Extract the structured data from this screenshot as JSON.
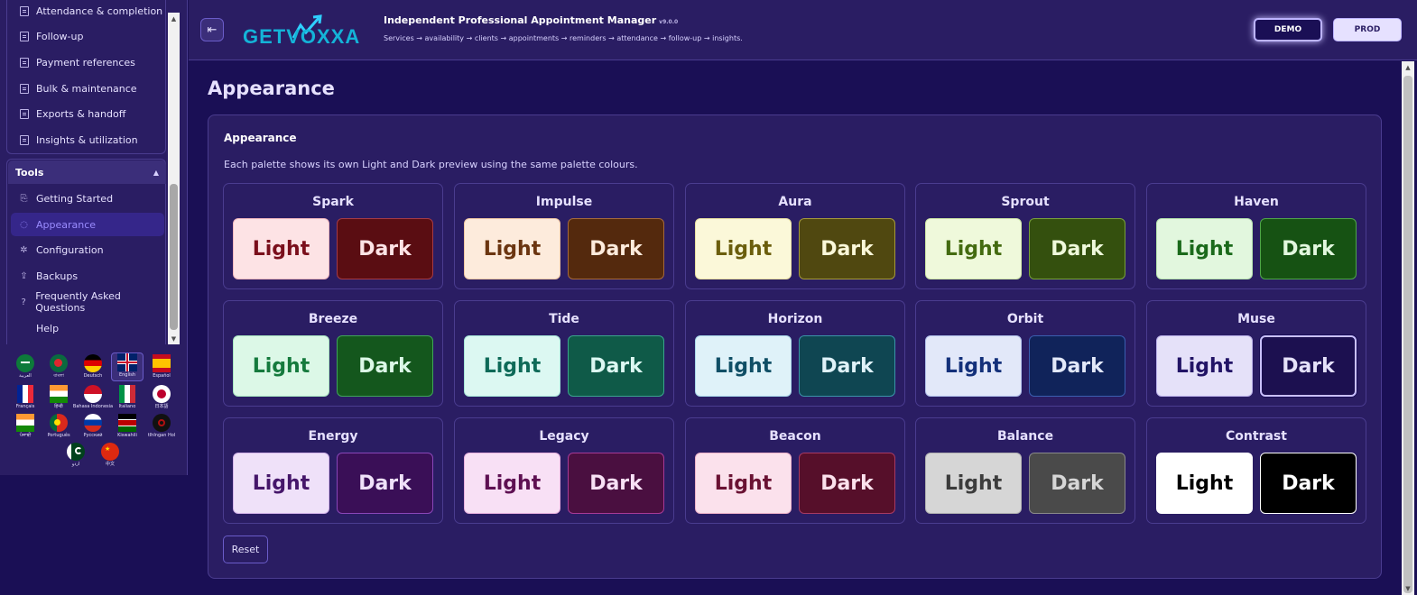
{
  "sidebar": {
    "partial_item": "Attendance & completion",
    "items": [
      {
        "label": "Follow-up"
      },
      {
        "label": "Payment references"
      },
      {
        "label": "Bulk & maintenance"
      },
      {
        "label": "Exports & handoff"
      },
      {
        "label": "Insights & utilization"
      }
    ],
    "tools": {
      "header": "Tools",
      "items": [
        {
          "label": "Getting Started",
          "icon": "start-icon"
        },
        {
          "label": "Appearance",
          "icon": "palette-icon",
          "active": true
        },
        {
          "label": "Configuration",
          "icon": "gear-icon"
        },
        {
          "label": "Backups",
          "icon": "upload-icon"
        },
        {
          "label": "Frequently Asked Questions",
          "icon": "help-circle-icon"
        },
        {
          "label": "Help",
          "icon": ""
        }
      ]
    },
    "languages": [
      {
        "label": "العربية",
        "code": "ar"
      },
      {
        "label": "বাংলা",
        "code": "bn"
      },
      {
        "label": "Deutsch",
        "code": "de"
      },
      {
        "label": "English",
        "code": "en",
        "selected": true
      },
      {
        "label": "Español",
        "code": "es"
      },
      {
        "label": "Français",
        "code": "fr"
      },
      {
        "label": "हिन्दी",
        "code": "hi"
      },
      {
        "label": "Bahasa Indonesia",
        "code": "id"
      },
      {
        "label": "Italiano",
        "code": "it"
      },
      {
        "label": "日本語",
        "code": "ja"
      },
      {
        "label": "ਪੰਜਾਬੀ",
        "code": "pa"
      },
      {
        "label": "Português",
        "code": "pt"
      },
      {
        "label": "Русский",
        "code": "ru"
      },
      {
        "label": "Kiswahili",
        "code": "sw"
      },
      {
        "label": "tlhIngan Hol",
        "code": "tlh"
      },
      {
        "label": "اردو",
        "code": "ur"
      },
      {
        "label": "中文",
        "code": "zh"
      }
    ]
  },
  "header": {
    "logo_text": "GETVOXXA",
    "app_title": "Independent Professional Appointment Manager",
    "version": "v9.0.0",
    "subtitle": "Services → availability → clients → appointments → reminders → attendance → follow-up → insights.",
    "env_demo": "DEMO",
    "env_prod": "PROD"
  },
  "main": {
    "page_title": "Appearance",
    "card_title": "Appearance",
    "description": "Each palette shows its own Light and Dark preview using the same palette colours.",
    "light_label": "Light",
    "dark_label": "Dark",
    "reset_label": "Reset",
    "selected_palette": "Muse",
    "selected_mode": "Dark",
    "palettes": [
      {
        "name": "Spark",
        "light_bg": "#fde3e5",
        "light_fg": "#7a0f1c",
        "light_border": "#f2b8bf",
        "dark_bg": "#5a0d12",
        "dark_fg": "#fde3e5",
        "dark_border": "#a53a44"
      },
      {
        "name": "Impulse",
        "light_bg": "#fdebdc",
        "light_fg": "#6b3510",
        "light_border": "#f0c7a3",
        "dark_bg": "#54290d",
        "dark_fg": "#fdebdc",
        "dark_border": "#a66a3a"
      },
      {
        "name": "Aura",
        "light_bg": "#fbf8d9",
        "light_fg": "#6b5e0c",
        "light_border": "#e9e0a1",
        "dark_bg": "#504810",
        "dark_fg": "#fbf8d9",
        "dark_border": "#a69a3a"
      },
      {
        "name": "Sprout",
        "light_bg": "#eff9db",
        "light_fg": "#446b10",
        "light_border": "#cde6a5",
        "dark_bg": "#34500e",
        "dark_fg": "#eff9db",
        "dark_border": "#79a23a"
      },
      {
        "name": "Haven",
        "light_bg": "#e2f7de",
        "light_fg": "#1b6a1b",
        "light_border": "#b5e3ad",
        "dark_bg": "#165213",
        "dark_fg": "#e2f7de",
        "dark_border": "#4ea548"
      },
      {
        "name": "Breeze",
        "light_bg": "#dcf8e7",
        "light_fg": "#157a3d",
        "light_border": "#a8e6c0",
        "dark_bg": "#14571d",
        "dark_fg": "#dcf8e7",
        "dark_border": "#3fa558"
      },
      {
        "name": "Tide",
        "light_bg": "#dcf8f2",
        "light_fg": "#0e6a58",
        "light_border": "#a6e6d8",
        "dark_bg": "#0f5a48",
        "dark_fg": "#dcf8f2",
        "dark_border": "#3aa58c"
      },
      {
        "name": "Horizon",
        "light_bg": "#dff2f9",
        "light_fg": "#104f66",
        "light_border": "#a9d8ea",
        "dark_bg": "#0f4652",
        "dark_fg": "#dff2f9",
        "dark_border": "#3a95a8"
      },
      {
        "name": "Orbit",
        "light_bg": "#e2e8f9",
        "light_fg": "#13307a",
        "light_border": "#b0bfea",
        "dark_bg": "#10235a",
        "dark_fg": "#e2e8f9",
        "dark_border": "#3a5fb0"
      },
      {
        "name": "Muse",
        "light_bg": "#e5e1f9",
        "light_fg": "#221466",
        "light_border": "#bbb1ea",
        "dark_bg": "#1c1050",
        "dark_fg": "#e5e1f9",
        "dark_border": "#c9c0ff"
      },
      {
        "name": "Energy",
        "light_bg": "#efe1f9",
        "light_fg": "#45166a",
        "light_border": "#d3b3ea",
        "dark_bg": "#3a0f57",
        "dark_fg": "#efe1f9",
        "dark_border": "#8a46b8"
      },
      {
        "name": "Legacy",
        "light_bg": "#f8e0f5",
        "light_fg": "#5e1052",
        "light_border": "#e7b0de",
        "dark_bg": "#4a0f40",
        "dark_fg": "#f8e0f5",
        "dark_border": "#a83a96"
      },
      {
        "name": "Beacon",
        "light_bg": "#fbe1ec",
        "light_fg": "#6a1233",
        "light_border": "#eeb2c9",
        "dark_bg": "#560f2a",
        "dark_fg": "#fbe1ec",
        "dark_border": "#a83a62"
      },
      {
        "name": "Balance",
        "light_bg": "#d6d6d6",
        "light_fg": "#3c3c3c",
        "light_border": "#b0b0b0",
        "dark_bg": "#4a4a4a",
        "dark_fg": "#d6d6d6",
        "dark_border": "#8a8a8a"
      },
      {
        "name": "Contrast",
        "light_bg": "#ffffff",
        "light_fg": "#000000",
        "light_border": "#ffffff",
        "dark_bg": "#000000",
        "dark_fg": "#ffffff",
        "dark_border": "#ffffff"
      }
    ]
  }
}
